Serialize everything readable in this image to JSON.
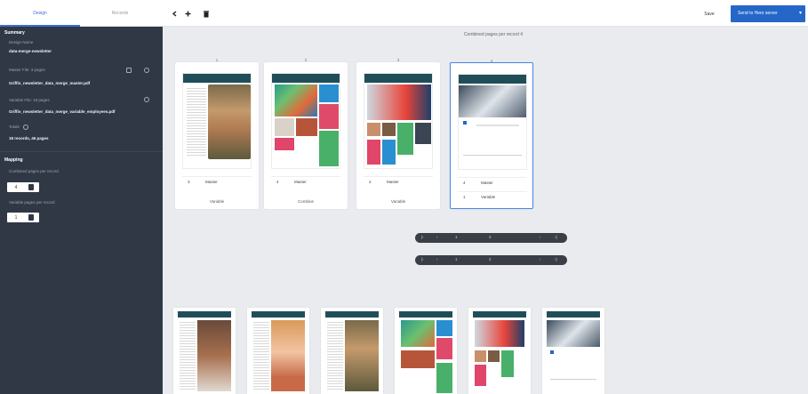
{
  "tabs": [
    {
      "label": "Design"
    },
    {
      "label": "Records"
    }
  ],
  "toolbar": {
    "icons": [
      "arrow-left-icon",
      "plus-icon",
      "trash-icon"
    ],
    "save_label": "Save",
    "send_label": "Send to Hero server"
  },
  "sidebar": {
    "summary_heading": "Summary",
    "design_name_label": "Design Name",
    "design_name_value": "data-merge-newsletter",
    "master_file_label": "Master File: 3 pages",
    "master_file_value": "Griffin_newsletter_data_merge_master.pdf",
    "variable_file_label": "Variable File: 18 pages",
    "variable_file_value": "Griffin_newsletter_data_merge_variable_employees.pdf",
    "totals_label": "Totals",
    "totals_value": "18 records, 46 pages",
    "mapping_heading": "Mapping",
    "combined_label": "Combined pages per record",
    "combined_value": "4",
    "variable_pages_label": "Variable pages per record",
    "variable_pages_value": "1"
  },
  "main": {
    "title": "Combined pages per record 4",
    "cards": [
      {
        "num": "1",
        "count": "3",
        "type": "Master",
        "footer": "Variable",
        "selected": false
      },
      {
        "num": "2",
        "count": "4",
        "type": "Master",
        "footer": "Combine",
        "selected": false
      },
      {
        "num": "3",
        "count": "2",
        "type": "Master",
        "footer": "Variable",
        "selected": false
      },
      {
        "num": "4",
        "count": "4",
        "type": "Master",
        "count2": "1",
        "footer": "Variable",
        "selected": true
      }
    ],
    "pagers": [
      {
        "page": "1",
        "of": "2"
      },
      {
        "page": "1",
        "of": "2"
      }
    ]
  },
  "colors": {
    "accent": "#2467c8",
    "sidebar": "#303846",
    "selection": "#4a86e8"
  }
}
